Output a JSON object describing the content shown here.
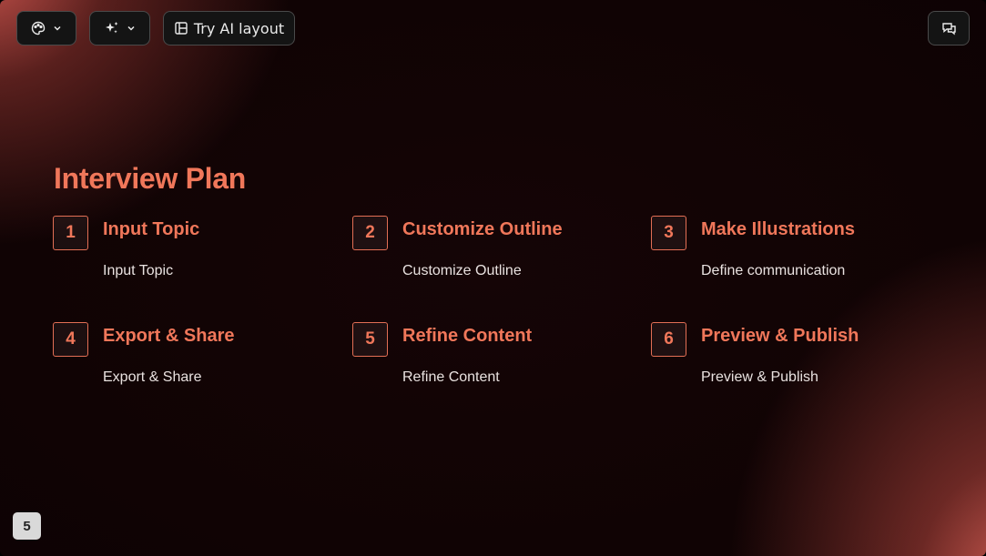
{
  "toolbar": {
    "theme_icon": "palette-icon",
    "ai_icon": "sparkle-icon",
    "layout_icon": "layout-icon",
    "layout_label": "Try AI layout",
    "comment_icon": "comment-icon"
  },
  "slide": {
    "title": "Interview Plan",
    "steps": [
      {
        "number": "1",
        "heading": "Input Topic",
        "description": "Input Topic"
      },
      {
        "number": "2",
        "heading": "Customize Outline",
        "description": "Customize Outline"
      },
      {
        "number": "3",
        "heading": "Make Illustrations",
        "description": "Define communication"
      },
      {
        "number": "4",
        "heading": "Export & Share",
        "description": "Export & Share"
      },
      {
        "number": "5",
        "heading": "Refine Content",
        "description": "Refine Content"
      },
      {
        "number": "6",
        "heading": "Preview & Publish",
        "description": "Preview & Publish"
      }
    ]
  },
  "page_number": "5",
  "colors": {
    "accent": "#f0775a",
    "background": "#100304",
    "glow": "#cd554e"
  }
}
